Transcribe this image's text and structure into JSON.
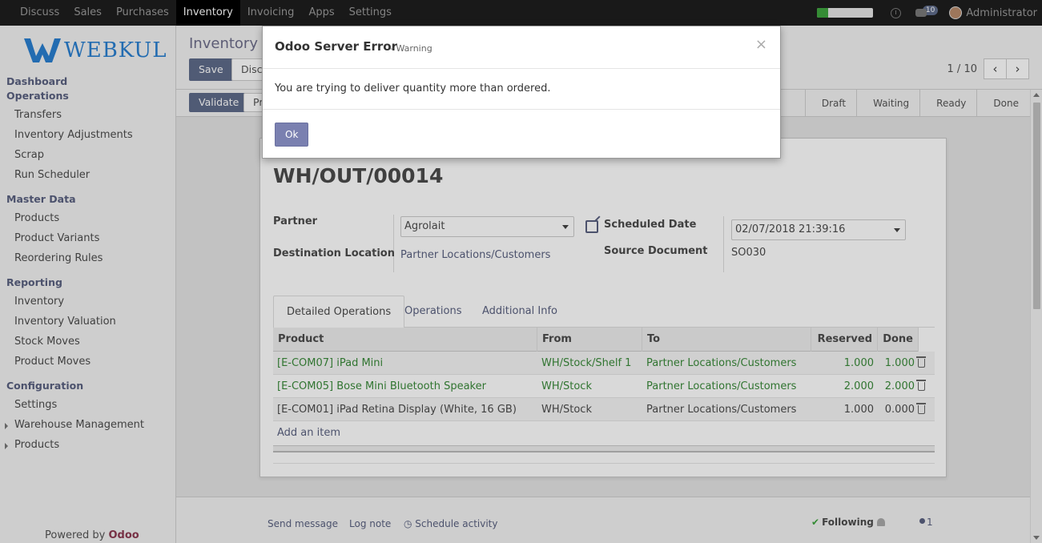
{
  "topnav": {
    "items": [
      {
        "label": "Discuss"
      },
      {
        "label": "Sales"
      },
      {
        "label": "Purchases"
      },
      {
        "label": "Inventory",
        "active": true
      },
      {
        "label": "Invoicing"
      },
      {
        "label": "Apps"
      },
      {
        "label": "Settings"
      }
    ],
    "progress_fraction": 0.2,
    "message_badge": "10",
    "user": "Administrator"
  },
  "sidebar": {
    "logo_text": "WEBKUL",
    "sections": {
      "dashboard": "Dashboard",
      "operations": "Operations",
      "master_data": "Master Data",
      "reporting": "Reporting",
      "configuration": "Configuration"
    },
    "operations_items": [
      "Transfers",
      "Inventory Adjustments",
      "Scrap",
      "Run Scheduler"
    ],
    "master_data_items": [
      "Products",
      "Product Variants",
      "Reordering Rules"
    ],
    "reporting_items": [
      "Inventory",
      "Inventory Valuation",
      "Stock Moves",
      "Product Moves"
    ],
    "configuration_items": [
      "Settings",
      "Warehouse Management",
      "Products"
    ],
    "powered_by": "Powered by",
    "powered_brand": "Odoo"
  },
  "control_panel": {
    "breadcrumb": "Inventory /",
    "save_label": "Save",
    "discard_label": "Disca",
    "pager_value": "1 / 10",
    "pager_prev": "‹",
    "pager_next": "›"
  },
  "statusbar": {
    "validate_label": "Validate",
    "print_label": "Pr",
    "stages": [
      "Draft",
      "Waiting",
      "Ready",
      "Done"
    ]
  },
  "form": {
    "reference": "WH/OUT/00014",
    "partner_label": "Partner",
    "partner_value": "Agrolait",
    "destination_label": "Destination Location",
    "destination_value": "Partner Locations/Customers",
    "scheduled_label": "Scheduled Date",
    "scheduled_value": "02/07/2018 21:39:16",
    "source_label": "Source Document",
    "source_value": "SO030",
    "tabs": [
      "Detailed Operations",
      "Operations",
      "Additional Info"
    ],
    "columns": [
      "Product",
      "From",
      "To",
      "Reserved",
      "Done"
    ],
    "rows": [
      {
        "product": "[E-COM07] iPad Mini",
        "from": "WH/Stock/Shelf 1",
        "to": "Partner Locations/Customers",
        "reserved": "1.000",
        "done": "1.000"
      },
      {
        "product": "[E-COM05] Bose Mini Bluetooth Speaker",
        "from": "WH/Stock",
        "to": "Partner Locations/Customers",
        "reserved": "2.000",
        "done": "2.000"
      },
      {
        "product": "[E-COM01] iPad Retina Display (White, 16 GB)",
        "from": "WH/Stock",
        "to": "Partner Locations/Customers",
        "reserved": "1.000",
        "done": "0.000"
      }
    ],
    "add_item": "Add an item"
  },
  "chatter": {
    "send_message": "Send message",
    "log_note": "Log note",
    "schedule_activity": "Schedule activity",
    "following": "Following",
    "followers_count": "1"
  },
  "modal": {
    "title": "Odoo Server Error",
    "subtitle": "- Warning",
    "close": "×",
    "message": "You are trying to deliver quantity more than ordered.",
    "ok_label": "Ok"
  }
}
